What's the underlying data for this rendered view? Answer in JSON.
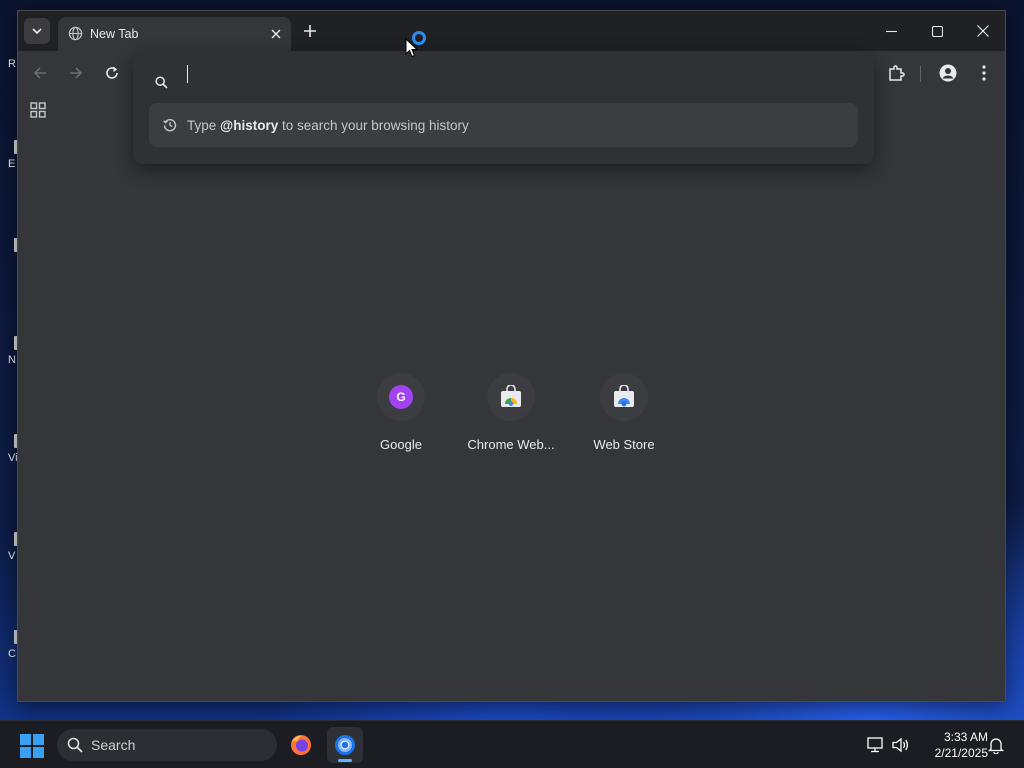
{
  "desktop": {
    "icons": [
      {
        "label": "R",
        "icon": "file-icon"
      },
      {
        "label": "E",
        "icon": "file-icon"
      },
      {
        "label": "",
        "icon": "file-icon"
      },
      {
        "label": "N",
        "icon": "file-icon"
      },
      {
        "label": "Vis",
        "icon": "file-icon"
      },
      {
        "label": "V",
        "icon": "file-icon"
      },
      {
        "label": "C",
        "icon": "file-icon"
      }
    ]
  },
  "browser": {
    "tab": {
      "title": "New Tab",
      "favicon": "globe-icon"
    },
    "omnibox": {
      "value": "",
      "suggestion_prefix": "Type ",
      "suggestion_keyword": "@history",
      "suggestion_suffix": " to search your browsing history",
      "suggestion_icon": "history-icon"
    },
    "shortcuts": [
      {
        "label": "Google",
        "icon": "google-g-icon",
        "badge": "G"
      },
      {
        "label": "Chrome Web...",
        "icon": "chrome-web-store-icon"
      },
      {
        "label": "Web Store",
        "icon": "chrome-web-store-icon"
      }
    ]
  },
  "taskbar": {
    "search_label": "Search",
    "time": "3:33 AM",
    "date": "2/21/2025",
    "apps": [
      "firefox-icon",
      "chrome-icon"
    ]
  },
  "colors": {
    "window_bg": "#35363a",
    "tabstrip_bg": "#202124",
    "accent": "#a142f4",
    "taskbar_indicator": "#5db3ff"
  }
}
